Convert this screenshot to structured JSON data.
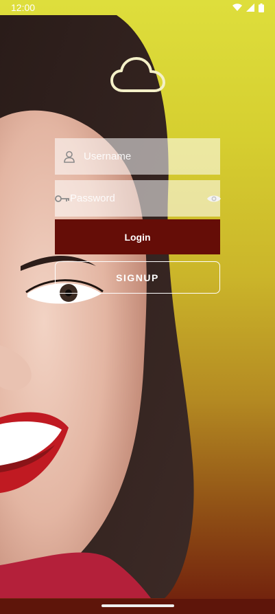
{
  "status_bar": {
    "time": "12:00",
    "icons": [
      "wifi-icon",
      "signal-icon",
      "battery-icon"
    ]
  },
  "app": {
    "logo_icon": "cloud-icon"
  },
  "form": {
    "username": {
      "placeholder": "Username",
      "value": "",
      "icon": "user-icon"
    },
    "password": {
      "placeholder": "Password",
      "value": "",
      "icon": "key-icon",
      "toggle_icon": "eye-icon"
    },
    "login_label": "Login",
    "signup_label": "SIGNUP"
  },
  "colors": {
    "login_button": "#650d07",
    "background_top": "#dede3c",
    "background_bottom": "#6e1c0c"
  }
}
